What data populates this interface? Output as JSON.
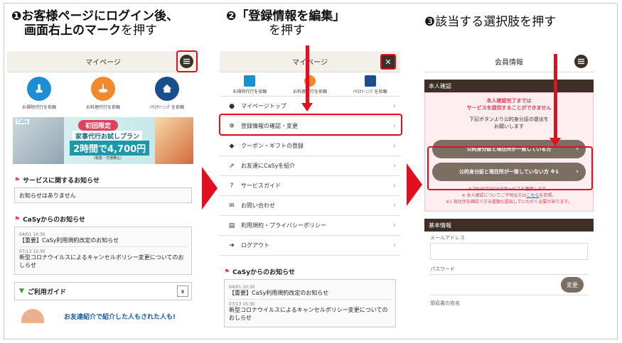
{
  "step1": {
    "title_line1": "❶お客様ページにログイン後、",
    "title_line2_bold": "画面右上のマーク",
    "title_line2_rest": "を押す"
  },
  "step2": {
    "title_line1": "❷「登録情報を編集」",
    "title_line2": "を押す"
  },
  "step3": {
    "title": "❸該当する選択肢を押す"
  },
  "screen1": {
    "header": "マイページ",
    "services": [
      {
        "label": "お掃除代行を依頼",
        "icon": "cleaning-icon",
        "color": "#1a8fd4"
      },
      {
        "label": "お料理代行を依頼",
        "icon": "cooking-icon",
        "color": "#f08a2c"
      },
      {
        "label": "ﾊｳｽｸﾘｰﾆﾝｸﾞを依頼",
        "icon": "house-cleaning-icon",
        "color": "#1a4e8c"
      }
    ],
    "banner": {
      "brand": "CaSy",
      "badge": "初回限定",
      "line1": "家事代行お試しプラン",
      "line2": "2時間で4,700円",
      "note": "(税抜・交通費込)"
    },
    "service_notice_title": "サービスに関するお知らせ",
    "service_notice_text": "お知らせはありません",
    "casy_notice_title": "CaSyからのお知らせ",
    "news": [
      {
        "date": "04/01 10:30",
        "text": "【重要】CaSy利用規約改定のお知らせ"
      },
      {
        "date": "07/13 15:30",
        "text": "新型コロナウイルスによるキャンセルポリシー変更についてのおしらせ"
      }
    ],
    "guide_label": "ご利用ガイド",
    "friend_promo": "お友達紹介で紹介した人もされた人も!"
  },
  "screen2": {
    "header": "マイページ",
    "services": [
      {
        "label": "お掃除代行を依頼"
      },
      {
        "label": "お料理代行を依頼"
      },
      {
        "label": "ﾊｳｽｸﾘｰﾆﾝｸﾞを依頼"
      }
    ],
    "menu": [
      {
        "label": "マイページトップ",
        "icon": "person-icon"
      },
      {
        "label": "登録情報の確認・変更",
        "icon": "gear-icon"
      },
      {
        "label": "クーポン・ギフトの登録",
        "icon": "tag-icon"
      },
      {
        "label": "お友達にCaSyを紹介",
        "icon": "share-icon"
      },
      {
        "label": "サービスガイド",
        "icon": "help-icon"
      },
      {
        "label": "お問い合わせ",
        "icon": "mail-icon"
      },
      {
        "label": "利用規約・プライバシーポリシー",
        "icon": "document-icon"
      },
      {
        "label": "ログアウト",
        "icon": "logout-icon"
      }
    ],
    "casy_notice_title": "CaSyからのお知らせ",
    "news": [
      {
        "date": "04/01 10:30",
        "text": "【重要】CaSy利用規約改定のお知らせ"
      },
      {
        "date": "07/13 15:30",
        "text": "新型コロナウイルスによるキャンセルポリシー変更についてのおしらせ"
      }
    ]
  },
  "screen3": {
    "header": "会員情報",
    "id_section_title": "本人確認",
    "warn_line1": "本人確認完了までは",
    "warn_line2": "サービスを提供することができません",
    "info_line1": "下記ボタンより公的身分証の提出を",
    "info_line2": "お願いします",
    "option1": "公的身分証と現住所が一致している方",
    "option2": "公的身分証と現住所が一致していない方 ※1",
    "note1": "※ TRUSTDOCKのサービスと連携します。",
    "note2_prefix": "※ 本人確認についてご不明な方は",
    "note2_link": "こちら",
    "note2_suffix": "を参照。",
    "note3": "※1 現住所を確認できる書類も提出していただく必要があります。",
    "basic_section_title": "基本情報",
    "email_label": "メールアドレス",
    "password_label": "パスワード",
    "change_button": "変更",
    "receipt_label": "領収書の宛名"
  }
}
